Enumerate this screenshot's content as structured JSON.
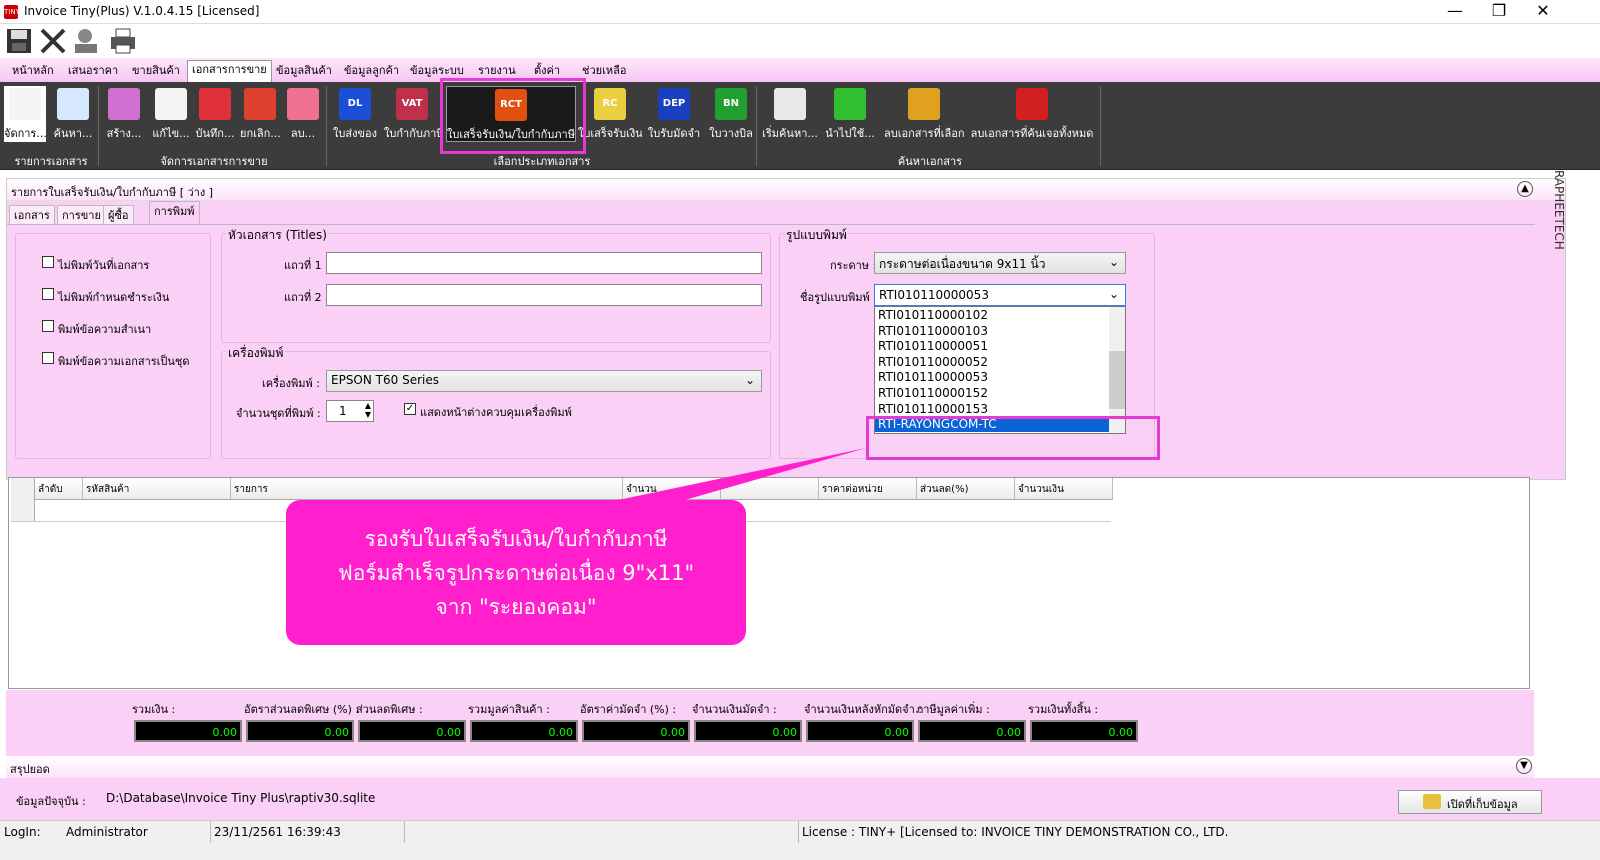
{
  "app": {
    "title": "Invoice Tiny(Plus)  V.1.0.4.15 [Licensed]",
    "icon_text": "TINY"
  },
  "window_buttons": [
    {
      "icon": "minimize-icon",
      "glyph": "—"
    },
    {
      "icon": "restore-icon",
      "glyph": "❐"
    },
    {
      "icon": "close-icon",
      "glyph": "✕"
    }
  ],
  "quick_access": [
    "save-icon",
    "tools-icon",
    "user-icon",
    "print-icon"
  ],
  "tabs": [
    "หน้าหลัก",
    "เสนอราคา",
    "ขายสินค้า",
    "เอกสารการขาย",
    "ข้อมูลสินค้า",
    "ข้อมูลลูกค้า",
    "ข้อมูลระบบ",
    "รายงาน",
    "ตั้งค่า",
    "ช่วยเหลือ"
  ],
  "ribbon": {
    "buttons": [
      {
        "label": "จัดการ...",
        "icon": "document-icon",
        "color": "#f4f4f4"
      },
      {
        "label": "ค้นหา...",
        "icon": "magnifier-icon",
        "color": "#d6e8ff"
      },
      {
        "label": "สร้าง...",
        "icon": "new-doc-icon",
        "color": "#d070d0"
      },
      {
        "label": "แก้ไข...",
        "icon": "edit-doc-icon",
        "color": "#f4f4f4"
      },
      {
        "label": "บันทึก...",
        "icon": "save-icon",
        "color": "#e0303a"
      },
      {
        "label": "ยกเลิก...",
        "icon": "cancel-icon",
        "color": "#e04030"
      },
      {
        "label": "ลบ...",
        "icon": "delete-icon",
        "color": "#f07090"
      },
      {
        "label": "ใบส่งของ",
        "icon": "dl-icon",
        "color": "#1a4fd6",
        "text": "DL"
      },
      {
        "label": "ใบกำกับภาษี",
        "icon": "vat-icon",
        "color": "#c0304a",
        "text": "VAT"
      },
      {
        "label": "ใบเสร็จรับเงิน/ใบกำกับภาษี",
        "icon": "rct-icon",
        "color": "#e05010",
        "text": "RCT"
      },
      {
        "label": "ใบเสร็จรับเงิน",
        "icon": "rc-icon",
        "color": "#e8d040",
        "text": "RC"
      },
      {
        "label": "ใบรับมัดจำ",
        "icon": "dep-icon",
        "color": "#1a40c0",
        "text": "DEP"
      },
      {
        "label": "ใบวางบิล",
        "icon": "bn-icon",
        "color": "#20a030",
        "text": "BN"
      },
      {
        "label": "เริ่มค้นหา...",
        "icon": "search-doc-icon",
        "color": "#e8e8e8"
      },
      {
        "label": "นำไปใช้...",
        "icon": "check-icon",
        "color": "#30c030"
      },
      {
        "label": "ลบเอกสารที่เลือก",
        "icon": "trash-one-icon",
        "color": "#e0a020"
      },
      {
        "label": "ลบเอกสารที่ค้นเจอทั้งหมด",
        "icon": "trash-all-icon",
        "color": "#d02020"
      }
    ],
    "groups": [
      "รายการเอกสาร",
      "จัดการเอกสารการขาย",
      "เลือกประเภทเอกสาร",
      "ค้นหาเอกสาร"
    ]
  },
  "panel": {
    "header": "รายการใบเสร็จรับเงิน/ใบกำกับภาษี [ ว่าง ]",
    "tabs": [
      "เอกสาร",
      "การขาย",
      "ผู้ซื้อ",
      "การพิมพ์"
    ],
    "checkboxes": [
      "ไม่พิมพ์วันที่เอกสาร",
      "ไม่พิมพ์กำหนดชำระเงิน",
      "พิมพ์ข้อความสำเนา",
      "พิมพ์ข้อความเอกสารเป็นชุด"
    ],
    "titles": {
      "legend": "หัวเอกสาร (Titles)",
      "line1_label": "แถวที่ 1",
      "line2_label": "แถวที่ 2",
      "line1": "",
      "line2": ""
    },
    "printer": {
      "legend": "เครื่องพิมพ์",
      "label": "เครื่องพิมพ์ :",
      "value": "EPSON T60 Series",
      "copies_label": "จำนวนชุดที่พิมพ์ :",
      "copies": "1",
      "show_dialog_label": "แสดงหน้าต่างควบคุมเครื่องพิมพ์",
      "show_dialog": true
    },
    "format": {
      "legend": "รูปแบบพิมพ์",
      "paper_label": "กระดาษ :",
      "paper_value": "กระดาษต่อเนื่องขนาด 9x11 นิ้ว",
      "form_label": "ชื่อรูปแบบพิมพ์ :",
      "form_value": "RTI010110000053",
      "options": [
        "RTI010110000102",
        "RTI010110000103",
        "RTI010110000051",
        "RTI010110000052",
        "RTI010110000053",
        "RTI010110000152",
        "RTI010110000153",
        "RTI-RAYONGCOM-TC"
      ],
      "selected": "RTI-RAYONGCOM-TC"
    }
  },
  "grid": {
    "columns": [
      "ลำดับ",
      "รหัสสินค้า",
      "รายการ",
      "จำนวน",
      "",
      "ราคาต่อหน่วย",
      "ส่วนลด(%)",
      "จำนวนเงิน"
    ]
  },
  "callout": {
    "line1": "รองรับใบเสร็จรับเงิน/ใบกำกับภาษี",
    "line2": "ฟอร์มสำเร็จรูปกระดาษต่อเนื่อง 9\"x11\"",
    "line3": "จาก \"ระยองคอม\""
  },
  "totals": [
    {
      "label": "รวมเงิน :",
      "value": "0.00"
    },
    {
      "label": "อัตราส่วนลดพิเศษ (%) :",
      "value": "0.00"
    },
    {
      "label": "ส่วนลดพิเศษ :",
      "value": "0.00"
    },
    {
      "label": "รวมมูลค่าสินค้า :",
      "value": "0.00"
    },
    {
      "label": "อัตราค่ามัดจำ (%) :",
      "value": "0.00"
    },
    {
      "label": "จำนวนเงินมัดจำ :",
      "value": "0.00"
    },
    {
      "label": "จำนวนเงินหลังหักมัดจำ :",
      "value": "0.00"
    },
    {
      "label": "ภาษีมูลค่าเพิ่ม :",
      "value": "0.00"
    },
    {
      "label": "รวมเงินทั้งสิ้น :",
      "value": "0.00"
    }
  ],
  "summary_label": "สรุปยอด",
  "db": {
    "label": "ข้อมูลปัจจุบัน :",
    "path": "D:\\Database\\Invoice Tiny Plus\\raptiv30.sqlite",
    "open_button": "เปิดที่เก็บข้อมูล"
  },
  "status": {
    "login_label": "LogIn:",
    "user": "Administrator",
    "datetime": "23/11/2561 16:39:43",
    "license": "License : TINY+ [Licensed to: INVOICE TINY DEMONSTRATION CO., LTD."
  },
  "side_label": "RAPHEETECH",
  "colors": {
    "accent": "#ff1fcc",
    "panel": "#fbd0f6",
    "ribbon": "#3c3c3c",
    "highlight": "#e63ad3"
  }
}
